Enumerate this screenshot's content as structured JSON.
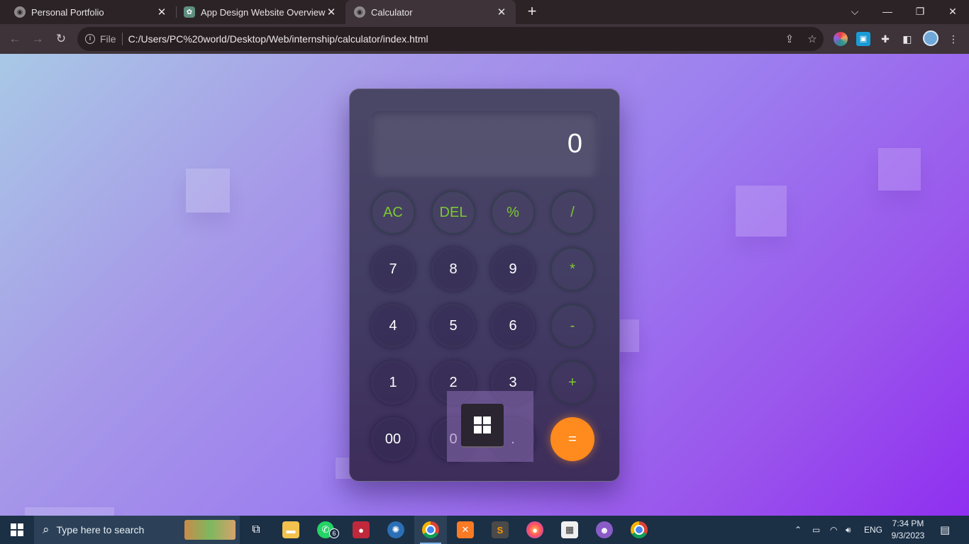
{
  "browser": {
    "tabs": [
      {
        "title": "Personal Portfolio",
        "active": false
      },
      {
        "title": "App Design Website Overview",
        "active": false
      },
      {
        "title": "Calculator",
        "active": true
      }
    ],
    "new_tab_label": "+",
    "window_controls": {
      "dropdown": "⌵",
      "minimize": "—",
      "restore": "❐",
      "close": "✕"
    },
    "omnibox": {
      "scheme_label": "File",
      "url": "C:/Users/PC%20world/Desktop/Web/internship/calculator/index.html"
    }
  },
  "calculator": {
    "display": "0",
    "keys": [
      {
        "label": "AC",
        "kind": "op"
      },
      {
        "label": "DEL",
        "kind": "op"
      },
      {
        "label": "%",
        "kind": "op"
      },
      {
        "label": "/",
        "kind": "op"
      },
      {
        "label": "7",
        "kind": "num"
      },
      {
        "label": "8",
        "kind": "num"
      },
      {
        "label": "9",
        "kind": "num"
      },
      {
        "label": "*",
        "kind": "op"
      },
      {
        "label": "4",
        "kind": "num"
      },
      {
        "label": "5",
        "kind": "num"
      },
      {
        "label": "6",
        "kind": "num"
      },
      {
        "label": "-",
        "kind": "op"
      },
      {
        "label": "1",
        "kind": "num"
      },
      {
        "label": "2",
        "kind": "num"
      },
      {
        "label": "3",
        "kind": "num"
      },
      {
        "label": "+",
        "kind": "op"
      },
      {
        "label": "00",
        "kind": "num"
      },
      {
        "label": "0",
        "kind": "num"
      },
      {
        "label": ".",
        "kind": "num"
      },
      {
        "label": "=",
        "kind": "eq"
      }
    ],
    "colors": {
      "operator_text": "#7ec832",
      "equals_bg": "#ff8a1d"
    }
  },
  "taskbar": {
    "search_placeholder": "Type here to search",
    "whatsapp_badge": "6",
    "language": "ENG",
    "time": "7:34 PM",
    "date": "9/3/2023"
  }
}
